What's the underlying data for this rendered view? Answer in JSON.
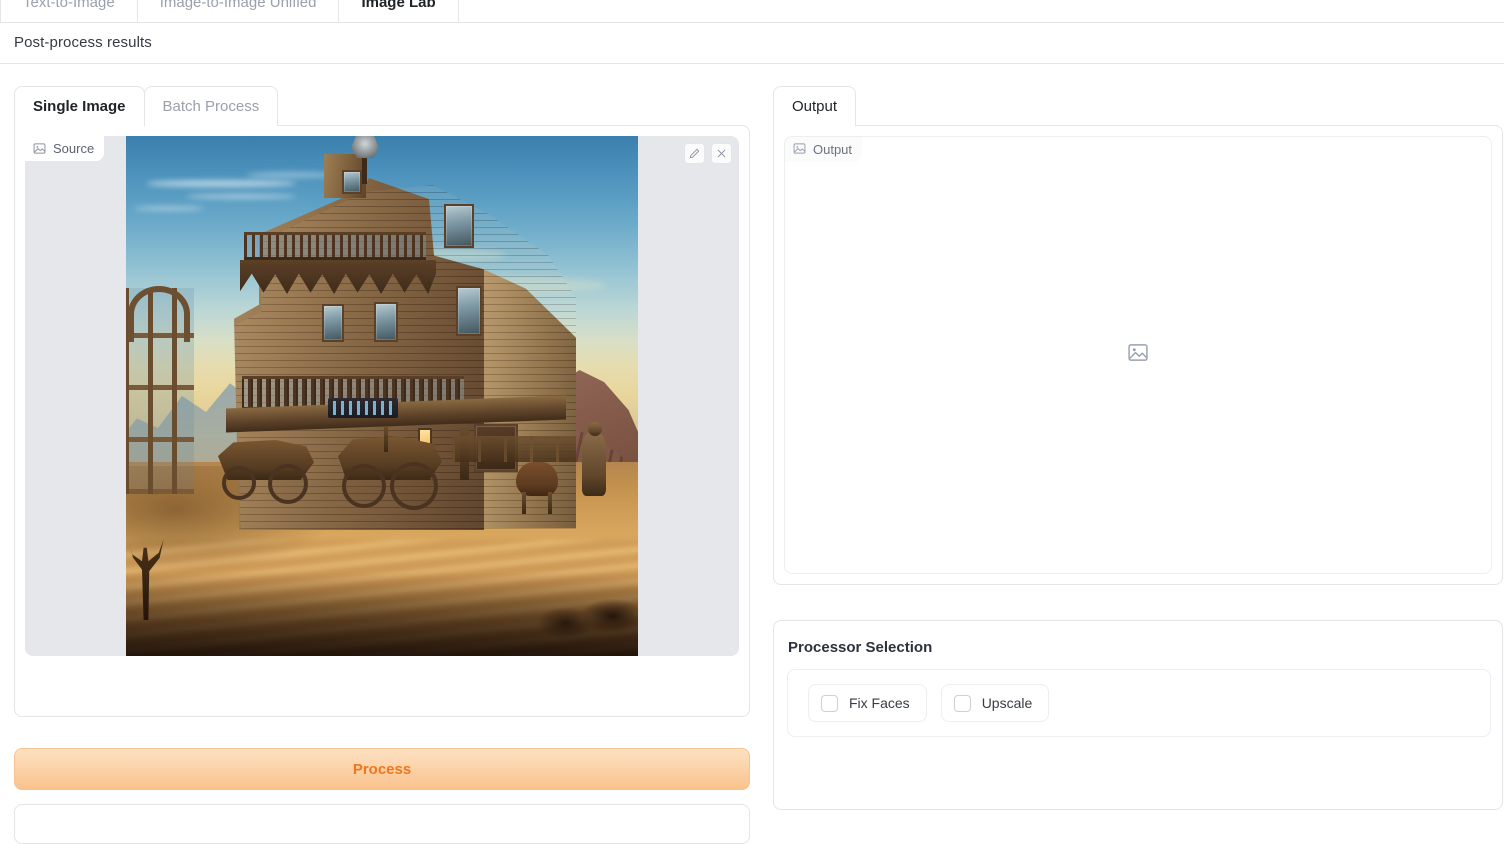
{
  "top_tabs": [
    {
      "label": "Text-to-Image",
      "active": false
    },
    {
      "label": "Image-to-Image Unified",
      "active": false
    },
    {
      "label": "Image Lab",
      "active": true
    }
  ],
  "header": {
    "title": "Post-process results"
  },
  "left": {
    "tabs": [
      {
        "label": "Single Image",
        "active": true
      },
      {
        "label": "Batch Process",
        "active": false
      }
    ],
    "source": {
      "badge_label": "Source",
      "badge_icon": "image-icon",
      "edit_icon": "pencil-icon",
      "close_icon": "close-icon",
      "artwork_description": "Digital painting of an old Western frontier town: a tall weathered wooden saloon with balconies and a lamp post, horse-drawn wagons and a horse on a dusty sunlit street, blue sky with thin clouds, distant blue-gray mountains and a red-rock butte at right."
    },
    "process_button": {
      "label": "Process"
    }
  },
  "right": {
    "tabs": [
      {
        "label": "Output",
        "active": true
      }
    ],
    "output": {
      "badge_label": "Output",
      "badge_icon": "image-icon",
      "empty_icon": "image-placeholder-icon"
    },
    "processor_selection": {
      "title": "Processor Selection",
      "options": [
        {
          "label": "Fix Faces",
          "checked": false
        },
        {
          "label": "Upscale",
          "checked": false
        }
      ]
    }
  },
  "colors": {
    "accent_orange": "#f0761d",
    "process_button_bg": "#fbd3a9",
    "panel_border": "#e3e5e9",
    "stage_bg": "#e5e7eb",
    "text_primary": "#1f2328",
    "text_muted": "#9aa0ac"
  }
}
